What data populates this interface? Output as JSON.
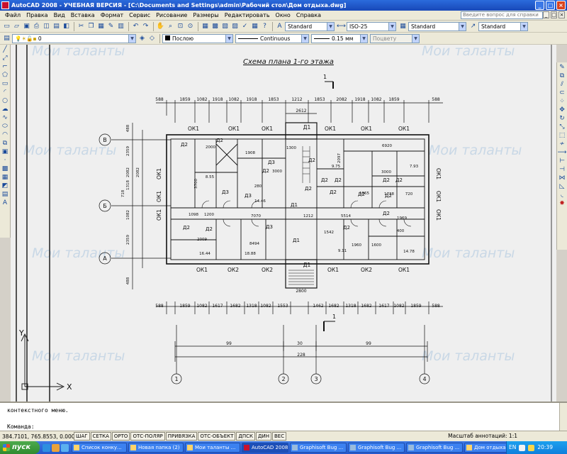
{
  "window": {
    "title": "AutoCAD 2008 - УЧЕБНАЯ ВЕРСИЯ - [C:\\Documents and Settings\\admin\\Рабочий стол\\Дом отдыха.dwg]",
    "controls": {
      "minimize": "_",
      "maximize": "□",
      "close": "×"
    }
  },
  "menubar": {
    "items": [
      "Файл",
      "Правка",
      "Вид",
      "Вставка",
      "Формат",
      "Сервис",
      "Рисование",
      "Размеры",
      "Редактировать",
      "Окно",
      "Справка"
    ],
    "help_search_placeholder": "Введите вопрос для справки"
  },
  "toolbar1": {
    "text_style": "Standard",
    "dim_style": "ISO-25",
    "table_style": "Standard",
    "mleader_style": "Standard"
  },
  "toolbar2": {
    "layer": "0",
    "color": "Послою",
    "linetype": "Continuous",
    "lineweight": "0.15 мм",
    "plot_style": "Поцвету"
  },
  "drawing": {
    "title": "Схема плана 1-го этажа",
    "watermark": "Мои таланты",
    "section_mark": "1",
    "axis_letters": [
      "В",
      "Б",
      "А"
    ],
    "axis_numbers": [
      "1",
      "2",
      "3",
      "4"
    ],
    "top_dims_outer": [
      "588",
      "1859",
      "1082",
      "1918",
      "1082",
      "1918",
      "1853",
      "1212",
      "1853",
      "2082",
      "1918",
      "1082",
      "1859",
      "588"
    ],
    "bottom_dims": [
      "588",
      "1859",
      "1082",
      "1617",
      "1682",
      "1318",
      "1082",
      "1553",
      "1462",
      "1682",
      "1318",
      "1682",
      "1617",
      "1082",
      "1859",
      "588"
    ],
    "bottom_overall": [
      "99",
      "30",
      "99",
      "228"
    ],
    "stair_width_top": "2612",
    "stair_width_bottom": "2800",
    "windows_top": [
      "ОК1",
      "ОК1",
      "ОК1",
      "Д1",
      "ОК1",
      "ОК1",
      "ОК1"
    ],
    "windows_bottom": [
      "ОК1",
      "ОК2",
      "ОК2",
      "Д1",
      "ОК1",
      "ОК2",
      "ОК1"
    ],
    "side_windows": [
      "ОК1",
      "ОК1",
      "ОК1"
    ],
    "room_labels": [
      "Д2",
      "Д2",
      "Д3",
      "Д3",
      "Д3",
      "Д2",
      "Д2",
      "Д2",
      "Д2",
      "Д1",
      "Д2",
      "Д2",
      "Д2",
      "Д2",
      "Д2",
      "Д2",
      "Д2",
      "Д1",
      "Д2",
      "Д2",
      "Д2",
      "Д3"
    ],
    "room_dims": [
      "2000",
      "1908",
      "1300",
      "6920",
      "3000",
      "3700",
      "8.55",
      "280",
      "14.46",
      "7070",
      "5514",
      "8494",
      "1212",
      "1960",
      "1600",
      "1542",
      "1969",
      "1865",
      "1738",
      "720",
      "2009",
      "1200",
      "1098",
      "2097",
      "3000",
      "400"
    ],
    "areas": [
      "9.75",
      "7.93",
      "16.44",
      "18.88",
      "9.11",
      "14.78"
    ],
    "left_dims": [
      "488",
      "2359",
      "2082",
      "1318",
      "2082",
      "718",
      "1082",
      "2359",
      "488"
    ]
  },
  "ucs": {
    "x": "X",
    "y": "Y"
  },
  "command": {
    "line1": "контекстного меню.",
    "prompt": "Команда:"
  },
  "status": {
    "coords": "384.7101, 765.8553, 0.0000",
    "buttons": [
      "ШАГ",
      "СЕТКА",
      "ОРТО",
      "ОТС-ПОЛЯР",
      "ПРИВЯЗКА",
      "ОТС-ОБЪЕКТ",
      "ДПСК",
      "ДИН",
      "ВЕС"
    ],
    "annotation_scale": "Масштаб аннотаций: 1:1"
  },
  "taskbar": {
    "start": "пуск",
    "tasks": [
      "Список конку...",
      "Новая папка (2)",
      "Мои таланты ...",
      "AutoCAD 2008...",
      "Graphisoft Bug ...",
      "Graphisoft Bug ...",
      "Graphisoft Bug ...",
      "Дом отдыха л..."
    ],
    "active_task": "AutoCAD 2008...",
    "lang": "EN",
    "clock": "20:39"
  },
  "colors": {
    "title_bar": "#1848b8",
    "canvas": "#efefef",
    "drawing_line": "#111111",
    "watermark": "#c9d8e6"
  }
}
